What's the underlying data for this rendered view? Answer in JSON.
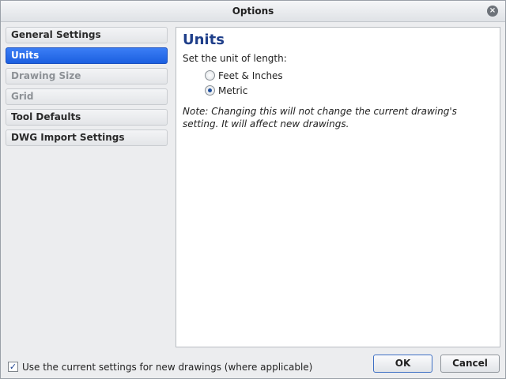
{
  "window": {
    "title": "Options",
    "close_glyph": "×"
  },
  "sidebar": {
    "items": [
      {
        "label": "General Settings",
        "state": "normal"
      },
      {
        "label": "Units",
        "state": "selected"
      },
      {
        "label": "Drawing Size",
        "state": "disabled"
      },
      {
        "label": "Grid",
        "state": "disabled"
      },
      {
        "label": "Tool Defaults",
        "state": "normal"
      },
      {
        "label": "DWG Import Settings",
        "state": "normal"
      }
    ]
  },
  "panel": {
    "title": "Units",
    "prompt": "Set the unit of length:",
    "options": [
      {
        "label": "Feet & Inches",
        "checked": false
      },
      {
        "label": "Metric",
        "checked": true
      }
    ],
    "note": "Note: Changing this will not change the current drawing's setting. It will affect new drawings."
  },
  "footer": {
    "checkbox_label": "Use the current settings for new drawings (where applicable)",
    "checkbox_checked": true,
    "check_glyph": "✓",
    "ok_label": "OK",
    "cancel_label": "Cancel"
  },
  "icons": {
    "close": "close-icon",
    "radio": "radio-icon",
    "checkbox": "checkbox-icon"
  },
  "colors": {
    "selected_item": "#1c5fe0",
    "panel_title": "#1f3f8a"
  }
}
